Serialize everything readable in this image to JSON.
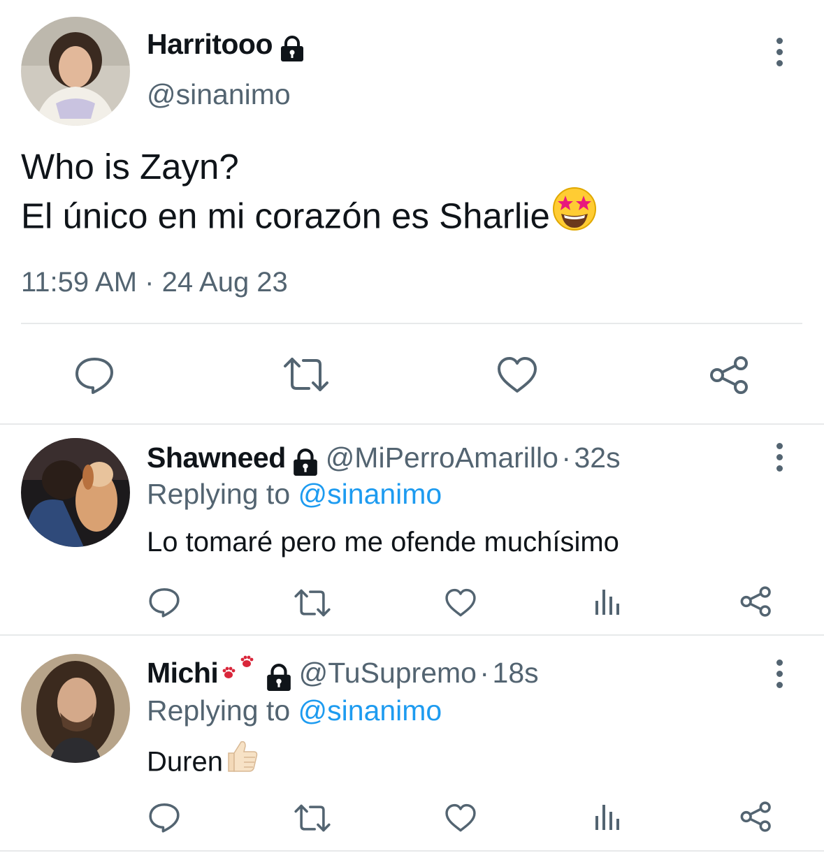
{
  "main_tweet": {
    "display_name": "Harritooo",
    "handle": "@sinanimo",
    "text_line1": "Who is Zayn?",
    "text_line2": "El único en mi corazón es Sharlie",
    "time": "11:59 AM",
    "separator": "·",
    "date": "24 Aug 23"
  },
  "replies": [
    {
      "display_name": "Shawneed",
      "handle": "@MiPerroAmarillo",
      "separator": "·",
      "age": "32s",
      "replying_prefix": "Replying to",
      "replying_to": "@sinanimo",
      "text": "Lo tomaré pero me ofende muchísimo"
    },
    {
      "display_name": "Michi",
      "handle": "@TuSupremo",
      "separator": "·",
      "age": "18s",
      "replying_prefix": "Replying to",
      "replying_to": "@sinanimo",
      "text": "Duren"
    }
  ],
  "icons": [
    "lock-icon",
    "more-options-icon",
    "reply-icon",
    "retweet-icon",
    "like-icon",
    "share-icon",
    "views-icon",
    "star-struck-emoji",
    "paw-prints-emoji",
    "thumbs-up-emoji"
  ],
  "colors": {
    "text": "#0f1419",
    "secondary": "#536471",
    "link": "#1d9bf0",
    "divider": "#e7e9ea"
  }
}
